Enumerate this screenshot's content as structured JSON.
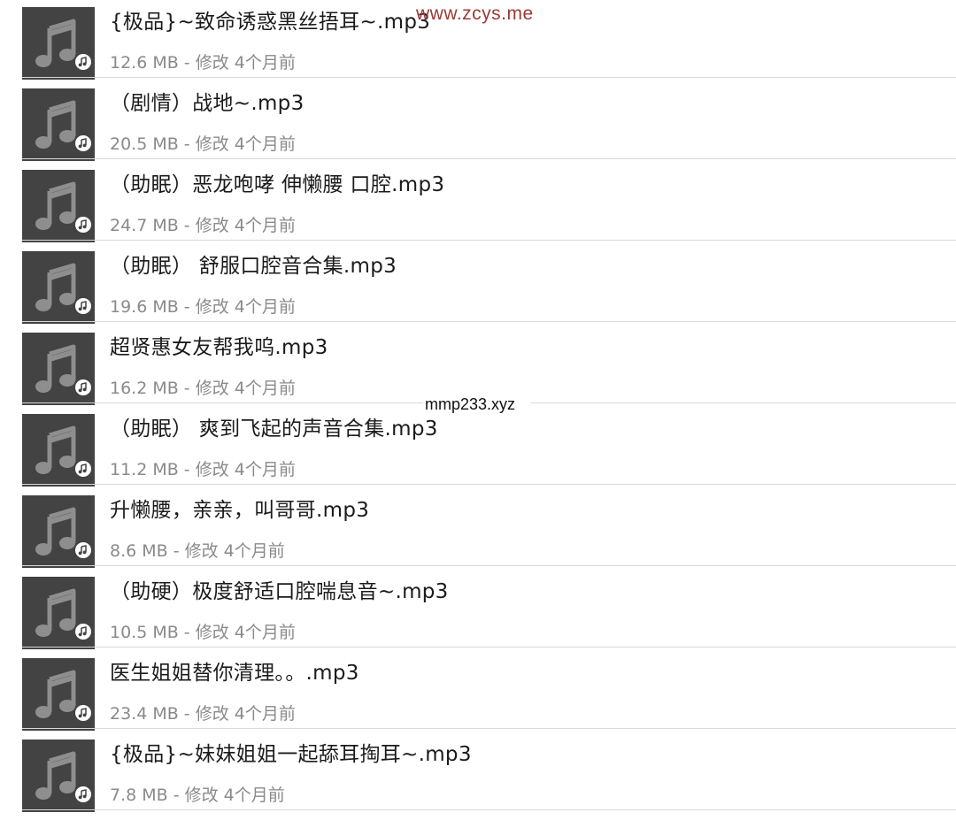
{
  "colors": {
    "thumb_bg": "#434343",
    "note": "#8e8e8e",
    "title_text": "#1b1b1b",
    "meta_text": "#8a8a8a",
    "divider": "#d9d9d9",
    "watermark_top": "#9b3a33"
  },
  "icons": {
    "thumbnail": "music-note-icon",
    "badge": "music-badge-icon"
  },
  "files": [
    {
      "name": "{极品}~致命诱惑黑丝捂耳~.mp3",
      "meta": "12.6 MB - 修改 4个月前"
    },
    {
      "name": "（剧情）战地~.mp3",
      "meta": "20.5 MB - 修改 4个月前"
    },
    {
      "name": "（助眠）恶龙咆哮 伸懒腰  口腔.mp3",
      "meta": "24.7 MB - 修改 4个月前"
    },
    {
      "name": "（助眠）  舒服口腔音合集.mp3",
      "meta": "19.6 MB - 修改 4个月前"
    },
    {
      "name": "超贤惠女友帮我呜.mp3",
      "meta": "16.2 MB - 修改 4个月前"
    },
    {
      "name": "（助眠） 爽到飞起的声音合集.mp3",
      "meta": "11.2 MB - 修改 4个月前"
    },
    {
      "name": "升懒腰，亲亲，叫哥哥.mp3",
      "meta": "8.6 MB - 修改 4个月前"
    },
    {
      "name": "（助硬）极度舒适口腔喘息音~.mp3",
      "meta": "10.5 MB - 修改 4个月前"
    },
    {
      "name": "医生姐姐替你清理。。.mp3",
      "meta": "23.4 MB - 修改 4个月前"
    },
    {
      "name": "{极品}~妹妹姐姐一起舔耳掏耳~.mp3",
      "meta": "7.8 MB - 修改 4个月前"
    }
  ],
  "watermarks": {
    "top": "www.zcys.me",
    "middle": "mmp233.xyz"
  }
}
